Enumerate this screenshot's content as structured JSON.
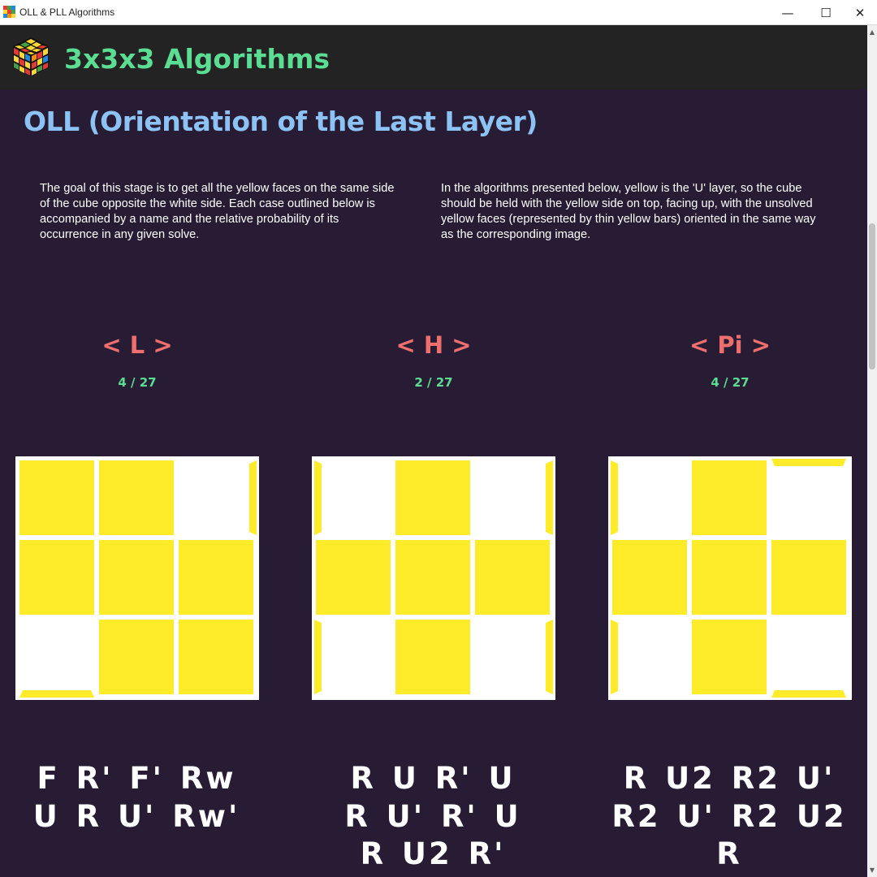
{
  "window": {
    "title": "OLL & PLL Algorithms",
    "minimize_glyph": "—",
    "maximize_glyph": "☐",
    "close_glyph": "✕"
  },
  "header": {
    "title": "3x3x3 Algorithms",
    "logo_icon": "rubiks-cube-icon"
  },
  "section": {
    "title": "OLL (Orientation of the Last Layer)",
    "intro_left": "The goal of this stage is to get all the yellow faces on the same side of the cube opposite the white side. Each case outlined below is accompanied by a name and the relative probability of its occurrence in any given solve.",
    "intro_right": "In the algorithms presented below, yellow is the 'U' layer, so the cube should be held with the yellow side on top, facing up, with the unsolved yellow faces (represented by thin yellow bars) oriented in the same way as the corresponding image."
  },
  "colors": {
    "background": "#271c33",
    "header_bg": "#232323",
    "title_green": "#5bdd94",
    "section_blue": "#8dc2f5",
    "case_name_red": "#ef6f6f",
    "sticker_yellow": "#feeb2a",
    "sticker_white": "#ffffff"
  },
  "cases": [
    {
      "name": "L",
      "probability": "4 / 27",
      "grid": [
        [
          1,
          1,
          0
        ],
        [
          1,
          1,
          1
        ],
        [
          0,
          1,
          1
        ]
      ],
      "bars": [
        "right-0",
        "bottom-0"
      ],
      "algorithm_lines": [
        "F R' F' Rw",
        "U R U' Rw'"
      ]
    },
    {
      "name": "H",
      "probability": "2 / 27",
      "grid": [
        [
          0,
          1,
          0
        ],
        [
          1,
          1,
          1
        ],
        [
          0,
          1,
          0
        ]
      ],
      "bars": [
        "left-0",
        "right-0",
        "left-2",
        "right-2"
      ],
      "algorithm_lines": [
        "R U R' U",
        "R U' R' U",
        "R U2 R'"
      ]
    },
    {
      "name": "Pi",
      "probability": "4 / 27",
      "grid": [
        [
          0,
          1,
          0
        ],
        [
          1,
          1,
          1
        ],
        [
          0,
          1,
          0
        ]
      ],
      "bars": [
        "left-0",
        "left-2",
        "top-2",
        "bottom-2"
      ],
      "algorithm_lines": [
        "R U2 R2 U'",
        "R2 U' R2 U2",
        "R"
      ]
    }
  ]
}
